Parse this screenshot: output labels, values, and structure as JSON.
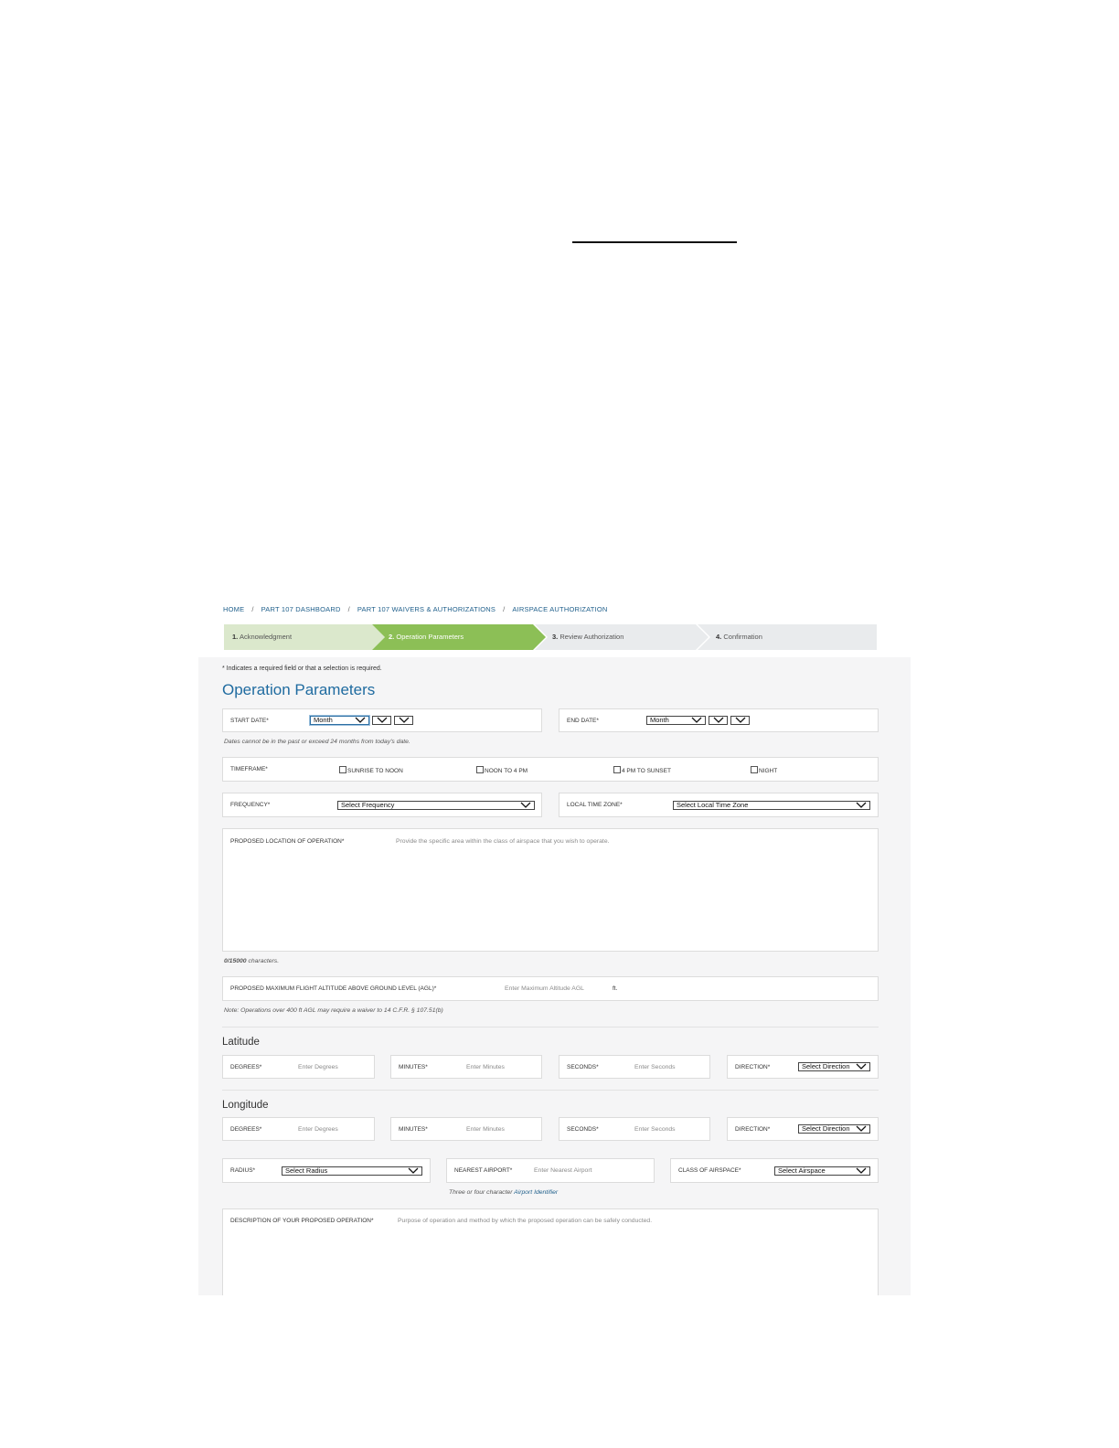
{
  "breadcrumb": [
    "HOME",
    "PART 107 DASHBOARD",
    "PART 107 WAIVERS & AUTHORIZATIONS",
    "AIRSPACE AUTHORIZATION"
  ],
  "steps": [
    {
      "num": "1.",
      "label": "Acknowledgment",
      "state": "complete"
    },
    {
      "num": "2.",
      "label": "Operation Parameters",
      "state": "active"
    },
    {
      "num": "3.",
      "label": "Review Authorization",
      "state": "upcoming"
    },
    {
      "num": "4.",
      "label": "Confirmation",
      "state": "upcoming"
    }
  ],
  "form": {
    "required_note": "* Indicates a required field or that a selection is required.",
    "title": "Operation Parameters",
    "start_date": {
      "label": "START DATE*",
      "month": "Month",
      "day": "",
      "year": ""
    },
    "end_date": {
      "label": "END DATE*",
      "month": "Month",
      "day": "",
      "year": ""
    },
    "date_hint": "Dates cannot be in the past or exceed 24 months from today's date.",
    "timeframe": {
      "label": "TIMEFRAME*",
      "options": [
        "SUNRISE TO NOON",
        "NOON TO 4 PM",
        "4 PM TO SUNSET",
        "NIGHT"
      ]
    },
    "frequency": {
      "label": "FREQUENCY*",
      "value": "Select Frequency"
    },
    "time_zone": {
      "label": "LOCAL TIME ZONE*",
      "value": "Select Local Time Zone"
    },
    "location": {
      "label": "PROPOSED LOCATION OF OPERATION*",
      "placeholder": "Provide the specific area within the class of airspace that you wish to operate."
    },
    "char_count": {
      "count": "0/15000",
      "suffix": " characters."
    },
    "altitude": {
      "label": "PROPOSED MAXIMUM FLIGHT ALTITUDE ABOVE GROUND LEVEL (AGL)*",
      "placeholder": "Enter Maximum Altitude AGL",
      "unit": "ft."
    },
    "altitude_note": "Note: Operations over 400 ft AGL may require a waiver to 14 C.F.R. § 107.51(b)",
    "latitude": {
      "heading": "Latitude",
      "degrees": {
        "label": "DEGREES*",
        "placeholder": "Enter Degrees"
      },
      "minutes": {
        "label": "MINUTES*",
        "placeholder": "Enter Minutes"
      },
      "seconds": {
        "label": "SECONDS*",
        "placeholder": "Enter Seconds"
      },
      "direction": {
        "label": "DIRECTION*",
        "value": "Select Direction"
      }
    },
    "longitude": {
      "heading": "Longitude",
      "degrees": {
        "label": "DEGREES*",
        "placeholder": "Enter Degrees"
      },
      "minutes": {
        "label": "MINUTES*",
        "placeholder": "Enter Minutes"
      },
      "seconds": {
        "label": "SECONDS*",
        "placeholder": "Enter Seconds"
      },
      "direction": {
        "label": "DIRECTION*",
        "value": "Select Direction"
      }
    },
    "radius": {
      "label": "RADIUS*",
      "value": "Select Radius"
    },
    "nearest_airport": {
      "label": "NEAREST AIRPORT*",
      "placeholder": "Enter Nearest Airport"
    },
    "airspace_class": {
      "label": "CLASS OF AIRSPACE*",
      "value": "Select Airspace"
    },
    "airport_hint": {
      "text": "Three or four character ",
      "link": "Airport Identifier"
    },
    "description": {
      "label": "DESCRIPTION OF YOUR PROPOSED OPERATION*",
      "placeholder": "Purpose of operation and method by which the proposed operation can be safely conducted."
    }
  }
}
